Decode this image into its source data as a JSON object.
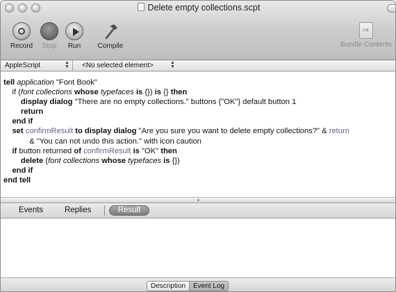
{
  "window": {
    "title": "Delete empty collections.scpt"
  },
  "toolbar": {
    "record_label": "Record",
    "stop_label": "Stop",
    "run_label": "Run",
    "compile_label": "Compile",
    "bundle_label": "Bundle Contents"
  },
  "navbar": {
    "language": "AppleScript",
    "element": "<No selected element>"
  },
  "script_lines": [
    [
      {
        "t": "tell",
        "s": "b"
      },
      {
        "t": " "
      },
      {
        "t": "application",
        "s": "i"
      },
      {
        "t": " \"Font Book\""
      }
    ],
    [
      {
        "t": "    if ("
      },
      {
        "t": "font collections",
        "s": "i"
      },
      {
        "t": " "
      },
      {
        "t": "whose",
        "s": "b"
      },
      {
        "t": " "
      },
      {
        "t": "typefaces",
        "s": "i"
      },
      {
        "t": " "
      },
      {
        "t": "is",
        "s": "b"
      },
      {
        "t": " {}) "
      },
      {
        "t": "is",
        "s": "b"
      },
      {
        "t": " {} "
      },
      {
        "t": "then",
        "s": "b"
      }
    ],
    [
      {
        "t": "        "
      },
      {
        "t": "display dialog",
        "s": "b"
      },
      {
        "t": " \"There are no empty collections.\" buttons {\"OK\"} default button 1"
      }
    ],
    [
      {
        "t": "        "
      },
      {
        "t": "return",
        "s": "b"
      }
    ],
    [
      {
        "t": "    "
      },
      {
        "t": "end if",
        "s": "b"
      }
    ],
    [
      {
        "t": "    "
      },
      {
        "t": "set",
        "s": "b"
      },
      {
        "t": " "
      },
      {
        "t": "confirmResult",
        "s": "g"
      },
      {
        "t": " "
      },
      {
        "t": "to",
        "s": "b"
      },
      {
        "t": " "
      },
      {
        "t": "display dialog",
        "s": "b"
      },
      {
        "t": " \"Are you sure you want to delete empty collections?\" & "
      },
      {
        "t": "return",
        "s": "g"
      }
    ],
    [
      {
        "t": "            & \"You can not undo this action.\" with icon caution"
      }
    ],
    [
      {
        "t": "    "
      },
      {
        "t": "if",
        "s": "b"
      },
      {
        "t": " button returned "
      },
      {
        "t": "of",
        "s": "b"
      },
      {
        "t": " "
      },
      {
        "t": "confirmResult",
        "s": "g"
      },
      {
        "t": " "
      },
      {
        "t": "is",
        "s": "b"
      },
      {
        "t": " \"OK\" "
      },
      {
        "t": "then",
        "s": "b"
      }
    ],
    [
      {
        "t": "        "
      },
      {
        "t": "delete",
        "s": "b"
      },
      {
        "t": " ("
      },
      {
        "t": "font collections",
        "s": "i"
      },
      {
        "t": " "
      },
      {
        "t": "whose",
        "s": "b"
      },
      {
        "t": " "
      },
      {
        "t": "typefaces",
        "s": "i"
      },
      {
        "t": " "
      },
      {
        "t": "is",
        "s": "b"
      },
      {
        "t": " {})"
      }
    ],
    [
      {
        "t": "    "
      },
      {
        "t": "end if",
        "s": "b"
      }
    ],
    [
      {
        "t": "end tell",
        "s": "b"
      }
    ]
  ],
  "result_tabs": {
    "events": "Events",
    "replies": "Replies",
    "result": "Result"
  },
  "bottom": {
    "description": "Description",
    "event_log": "Event Log"
  }
}
